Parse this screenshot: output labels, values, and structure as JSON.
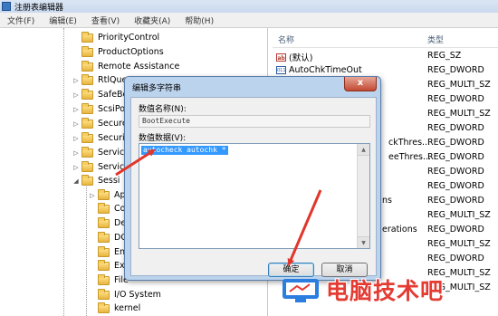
{
  "window": {
    "title": "注册表编辑器"
  },
  "menu": [
    "文件(F)",
    "编辑(E)",
    "查看(V)",
    "收藏夹(A)",
    "帮助(H)"
  ],
  "tree": {
    "items": [
      {
        "label": "PriorityControl",
        "expander": ""
      },
      {
        "label": "ProductOptions",
        "expander": ""
      },
      {
        "label": "Remote Assistance",
        "expander": ""
      },
      {
        "label": "RtlQue",
        "expander": "▷"
      },
      {
        "label": "SafeBo",
        "expander": "▷"
      },
      {
        "label": "ScsiPo",
        "expander": "▷"
      },
      {
        "label": "Secure",
        "expander": "▷"
      },
      {
        "label": "Security",
        "expander": "▷"
      },
      {
        "label": "Service",
        "expander": "▷"
      },
      {
        "label": "Service",
        "expander": "▷"
      },
      {
        "label": "Sessi",
        "expander": "◢"
      }
    ],
    "subitems": [
      {
        "label": "App",
        "expander": "▷"
      },
      {
        "label": "Con",
        "expander": ""
      },
      {
        "label": "Deb",
        "expander": ""
      },
      {
        "label": "DOS",
        "expander": ""
      },
      {
        "label": "Envi",
        "expander": ""
      },
      {
        "label": "Exec",
        "expander": ""
      },
      {
        "label": "File",
        "expander": ""
      },
      {
        "label": "I/O System",
        "expander": ""
      },
      {
        "label": "kernel",
        "expander": ""
      }
    ]
  },
  "list": {
    "headers": {
      "name": "名称",
      "type": "类型"
    },
    "rows": [
      {
        "name": "(默认)",
        "type": "REG_SZ",
        "icon": "ab"
      },
      {
        "name": "AutoChkTimeOut",
        "type": "REG_DWORD",
        "icon": "bin"
      },
      {
        "name": "",
        "type": "REG_MULTI_SZ",
        "icon": ""
      },
      {
        "name": "",
        "type": "REG_DWORD",
        "icon": ""
      },
      {
        "name": "",
        "type": "REG_MULTI_SZ",
        "icon": ""
      },
      {
        "name": "",
        "type": "REG_DWORD",
        "icon": ""
      },
      {
        "name": "ckThres...",
        "type": "REG_DWORD",
        "icon": ""
      },
      {
        "name": "eeThres...",
        "type": "REG_DWORD",
        "icon": ""
      },
      {
        "name": "",
        "type": "REG_DWORD",
        "icon": ""
      },
      {
        "name": "",
        "type": "REG_DWORD",
        "icon": ""
      },
      {
        "name": "ns",
        "type": "REG_DWORD",
        "icon": ""
      },
      {
        "name": "",
        "type": "REG_MULTI_SZ",
        "icon": ""
      },
      {
        "name": "erations",
        "type": "REG_DWORD",
        "icon": ""
      },
      {
        "name": "",
        "type": "REG_MULTI_SZ",
        "icon": ""
      },
      {
        "name": "",
        "type": "REG_DWORD",
        "icon": ""
      },
      {
        "name": "",
        "type": "REG_MULTI_SZ",
        "icon": ""
      },
      {
        "name": "",
        "type": "REG_MULTI_SZ",
        "icon": ""
      }
    ]
  },
  "dialog": {
    "title": "编辑多字符串",
    "close_glyph": "x",
    "value_name_label": "数值名称(N):",
    "value_name": "BootExecute",
    "value_data_label": "数值数据(V):",
    "value_data": "autocheck autochk *",
    "ok_label": "确定",
    "cancel_label": "取消"
  },
  "watermark": {
    "text": "电脑技术吧"
  },
  "colors": {
    "arrow": "#e0362b",
    "selection": "#3399ff",
    "dialog_frame": "#bcd3ee"
  }
}
